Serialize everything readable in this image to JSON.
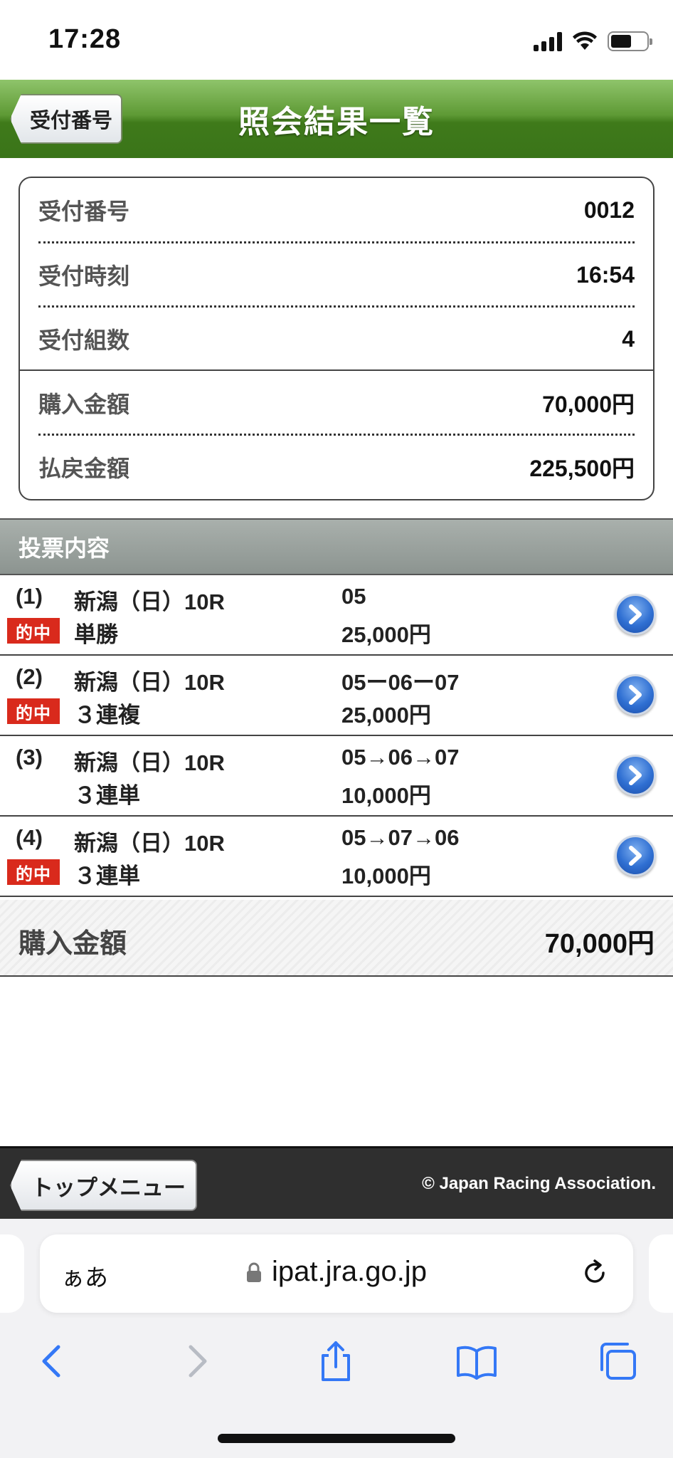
{
  "status_bar": {
    "time": "17:28"
  },
  "header": {
    "back_label": "受付番号",
    "title": "照会結果一覧"
  },
  "summary": {
    "rows": [
      {
        "label": "受付番号",
        "value": "0012"
      },
      {
        "label": "受付時刻",
        "value": "16:54"
      },
      {
        "label": "受付組数",
        "value": "4"
      },
      {
        "label": "購入金額",
        "value": "70,000円"
      },
      {
        "label": "払戻金額",
        "value": "225,500円"
      }
    ]
  },
  "votes": {
    "section_title": "投票内容",
    "hit_label": "的中",
    "items": [
      {
        "num": "(1)",
        "race": "新潟（日）10R",
        "type": "単勝",
        "combo": "05",
        "amount": "25,000円",
        "hit": true
      },
      {
        "num": "(2)",
        "race": "新潟（日）10R",
        "type": "３連複",
        "combo": "05ー06ー07",
        "amount": "25,000円",
        "hit": true
      },
      {
        "num": "(3)",
        "race": "新潟（日）10R",
        "type": "３連単",
        "combo": "05→06→07",
        "amount": "10,000円",
        "hit": false
      },
      {
        "num": "(4)",
        "race": "新潟（日）10R",
        "type": "３連単",
        "combo": "05→07→06",
        "amount": "10,000円",
        "hit": true
      }
    ]
  },
  "total": {
    "label": "購入金額",
    "value": "70,000円"
  },
  "footer": {
    "top_menu_label": "トップメニュー",
    "copyright": "© Japan Racing Association."
  },
  "browser": {
    "aa_label": "ぁあ",
    "url": "ipat.jra.go.jp"
  },
  "colors": {
    "header_green": "#3f7a1a",
    "hit_red": "#d92a1c",
    "arrow_blue": "#2f6fd2",
    "ios_blue": "#3478f6"
  }
}
